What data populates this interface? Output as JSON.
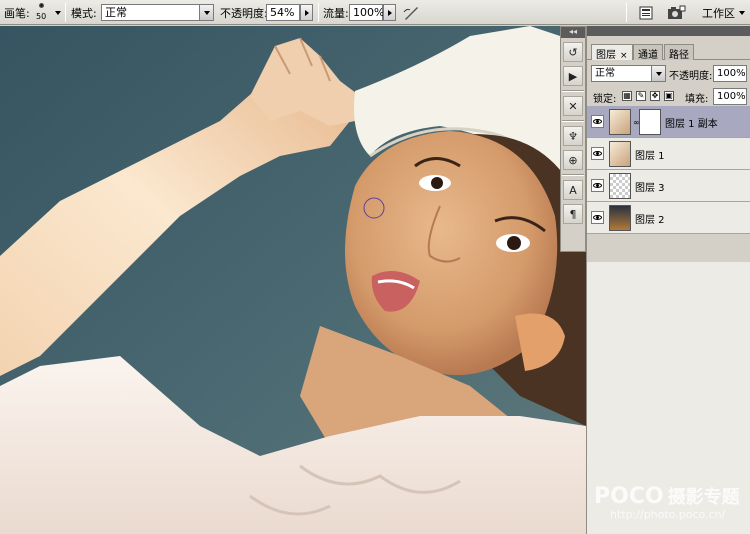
{
  "options_bar": {
    "brush_label": "画笔:",
    "brush_size": "50",
    "mode_label": "模式:",
    "mode_value": "正常",
    "opacity_label": "不透明度:",
    "opacity_value": "54%",
    "flow_label": "流量:",
    "flow_value": "100%",
    "workspace_label": "工作区"
  },
  "layers_panel": {
    "tabs": [
      {
        "label": "图层",
        "active": true
      },
      {
        "label": "通道",
        "active": false
      },
      {
        "label": "路径",
        "active": false
      }
    ],
    "blend_mode": "正常",
    "opacity_label": "不透明度:",
    "opacity_value": "100%",
    "lock_label": "锁定:",
    "fill_label": "填充:",
    "fill_value": "100%",
    "layers": [
      {
        "name": "图层 1 副本",
        "selected": true,
        "visible": true,
        "has_mask": true
      },
      {
        "name": "图层 1",
        "selected": false,
        "visible": true,
        "has_mask": false
      },
      {
        "name": "图层 3",
        "selected": false,
        "visible": true,
        "has_mask": false
      },
      {
        "name": "图层 2",
        "selected": false,
        "visible": true,
        "has_mask": false
      }
    ]
  },
  "tool_strip": {
    "collapse_glyph": "◂◂",
    "icons": [
      "history-icon",
      "actions-icon",
      "tool-presets-icon",
      "brushes-icon",
      "clone-source-icon",
      "character-icon",
      "paragraph-icon"
    ]
  },
  "watermark": {
    "brand": "POCO",
    "brand_cn": "摄影专题",
    "url": "http://photo.poco.cn/"
  },
  "colors": {
    "selected_layer": "#a8a8c0",
    "brush_cursor": "#5b3fa0"
  }
}
